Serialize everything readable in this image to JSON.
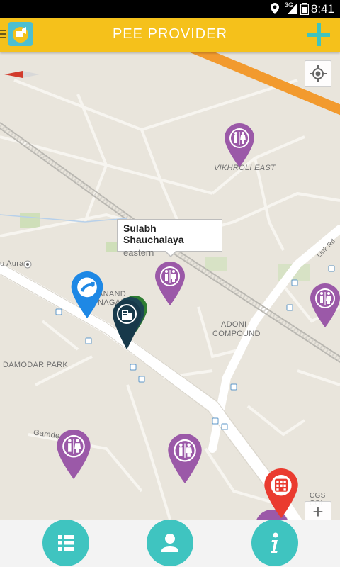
{
  "status_bar": {
    "time": "8:41",
    "network": "3G"
  },
  "app_bar": {
    "title": "PEE PROVIDER",
    "menu_icon": "menu-icon",
    "logo_icon": "app-logo-icon",
    "add_icon": "plus-icon"
  },
  "map": {
    "labels": {
      "vikhroli_east": "VIKHROLI EAST",
      "anand_nagar_1": "ANAND",
      "anand_nagar_2": "NAGAR",
      "adoni_1": "ADONI",
      "adoni_2": "COMPOUND",
      "damodar_park": "DAMODAR PARK",
      "gamdevi": "Gamde",
      "link_rd": "Link Rd",
      "aura": "u Aura",
      "cgs": "CGS COL"
    },
    "selected_marker": {
      "title": "Sulabh Shauchalaya",
      "subtitle": "eastern"
    },
    "controls": {
      "zoom_in": "+",
      "locate_icon": "my-location-icon"
    }
  },
  "colors": {
    "accent": "#f5c11b",
    "teal": "#3fc4c0",
    "toilet_pin": "#9b59a8",
    "fuel_pin": "#1e88e5",
    "hotel_pin": "#17394a",
    "hospital_pin": "#ea3b2f"
  },
  "bottom_bar": {
    "list_icon": "list-icon",
    "profile_icon": "person-icon",
    "info_icon": "info-icon"
  }
}
